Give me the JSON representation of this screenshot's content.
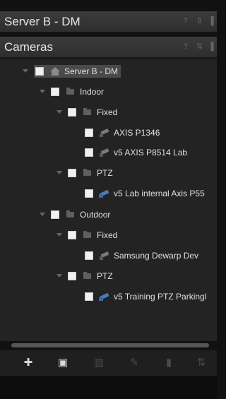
{
  "panel_header": {
    "title": "Server B - DM"
  },
  "cameras_header": {
    "title": "Cameras"
  },
  "tree": {
    "server": "Server B - DM",
    "indoor": "Indoor",
    "indoor_fixed": "Fixed",
    "cam1": "AXIS P1346",
    "cam2": "v5 AXIS P8514 Lab",
    "indoor_ptz": "PTZ",
    "cam3": "v5 Lab internal Axis P55",
    "outdoor": "Outdoor",
    "outdoor_fixed": "Fixed",
    "cam4": "Samsung Dewarp Dev",
    "outdoor_ptz": "PTZ",
    "cam5": "v5 Training PTZ Parkingl"
  },
  "toolbar": {
    "add_camera_icon": "plus-camera-icon",
    "add_folder_icon": "folder-plus-icon",
    "copy_icon": "copy-icon",
    "edit_icon": "pencil-icon",
    "delete_icon": "trash-icon",
    "sort_icon": "sort-az-icon"
  }
}
